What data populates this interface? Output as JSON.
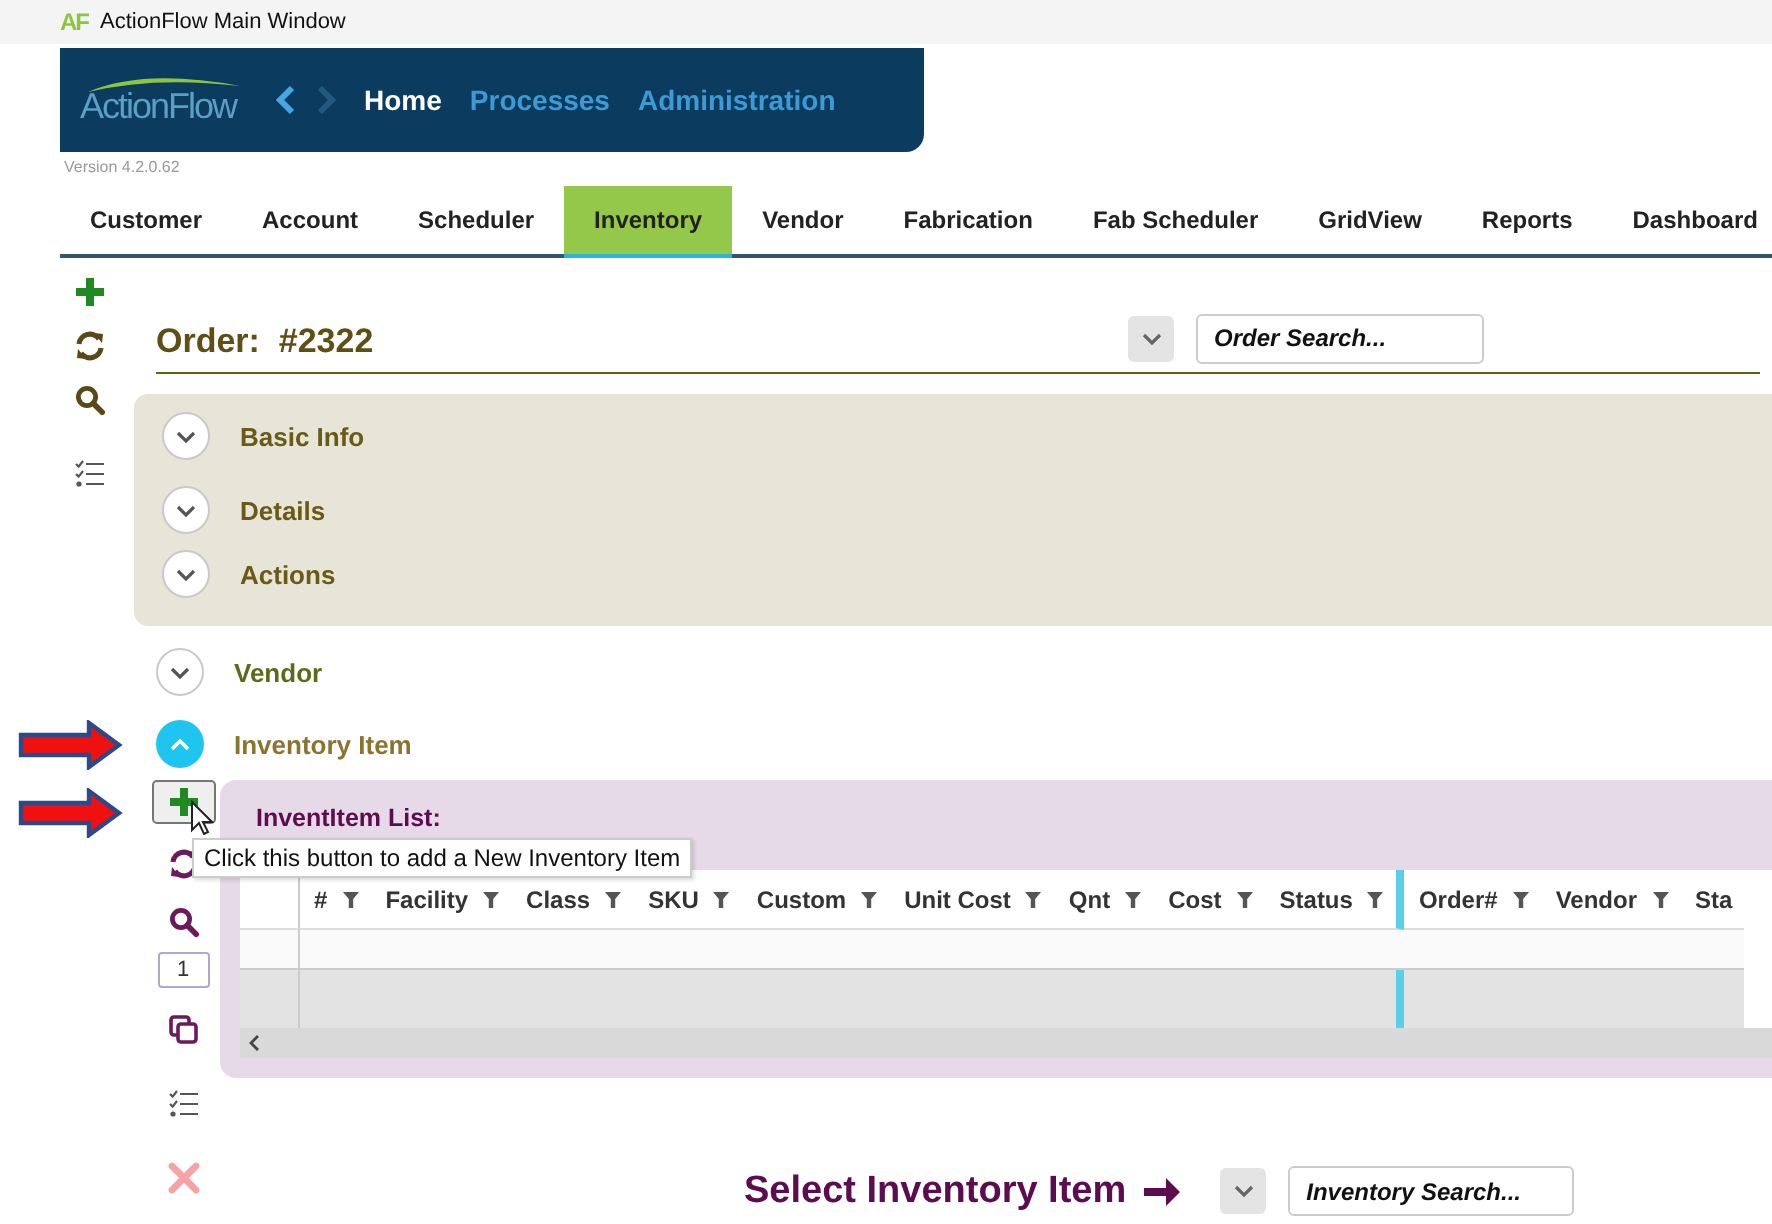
{
  "window": {
    "icon_text": "AF",
    "title": "ActionFlow Main Window"
  },
  "header": {
    "logo": "ActionFlow",
    "nav": [
      {
        "label": "Home",
        "selected": true
      },
      {
        "label": "Processes",
        "selected": false
      },
      {
        "label": "Administration",
        "selected": false
      }
    ]
  },
  "version": "Version 4.2.0.62",
  "tabs": [
    {
      "label": "Customer",
      "selected": false
    },
    {
      "label": "Account",
      "selected": false
    },
    {
      "label": "Scheduler",
      "selected": false
    },
    {
      "label": "Inventory",
      "selected": true
    },
    {
      "label": "Vendor",
      "selected": false
    },
    {
      "label": "Fabrication",
      "selected": false
    },
    {
      "label": "Fab Scheduler",
      "selected": false
    },
    {
      "label": "GridView",
      "selected": false
    },
    {
      "label": "Reports",
      "selected": false
    },
    {
      "label": "Dashboard",
      "selected": false
    }
  ],
  "order": {
    "title": "Order:  #2322",
    "search": {
      "placeholder": "Order Search..."
    },
    "sections": [
      {
        "label": "Basic Info",
        "expanded": false
      },
      {
        "label": "Details",
        "expanded": false
      },
      {
        "label": "Actions",
        "expanded": false
      }
    ]
  },
  "sections": [
    {
      "label": "Vendor",
      "expanded": false
    },
    {
      "label": "Inventory Item",
      "expanded": true
    }
  ],
  "inventory_list": {
    "title": "InventItem List:",
    "page": "1",
    "tooltip": "Click this button to add a New Inventory Item",
    "columns": [
      {
        "label": "#",
        "frozen_edge": false
      },
      {
        "label": "Facility",
        "frozen_edge": false
      },
      {
        "label": "Class",
        "frozen_edge": false
      },
      {
        "label": "SKU",
        "frozen_edge": false
      },
      {
        "label": "Custom",
        "frozen_edge": false
      },
      {
        "label": "Unit Cost",
        "frozen_edge": false
      },
      {
        "label": "Qnt",
        "frozen_edge": false
      },
      {
        "label": "Cost",
        "frozen_edge": false
      },
      {
        "label": "Status",
        "frozen_edge": true
      },
      {
        "label": "Order#",
        "frozen_edge": false
      },
      {
        "label": "Vendor",
        "frozen_edge": false
      },
      {
        "label": "Sta",
        "frozen_edge": false
      }
    ]
  },
  "select": {
    "label": "Select Inventory Item",
    "search": {
      "placeholder": "Inventory Search..."
    }
  }
}
